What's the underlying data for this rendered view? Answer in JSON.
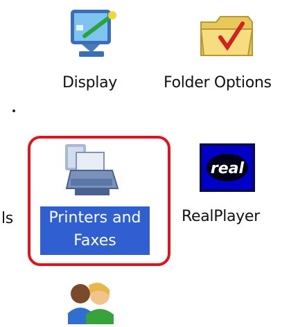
{
  "icons": {
    "display": {
      "label": "Display"
    },
    "folder_options": {
      "label": "Folder Options"
    },
    "printers_and_faxes": {
      "label_line1": "Printers and",
      "label_line2": "Faxes"
    },
    "realplayer": {
      "label": "RealPlayer",
      "logo_text": "real"
    },
    "partial_left": {
      "label": "ls"
    },
    "user_accounts": {
      "label": ""
    }
  },
  "colors": {
    "selection_outline": "#e0141e",
    "selected_label_bg": "#2f5fd0"
  }
}
